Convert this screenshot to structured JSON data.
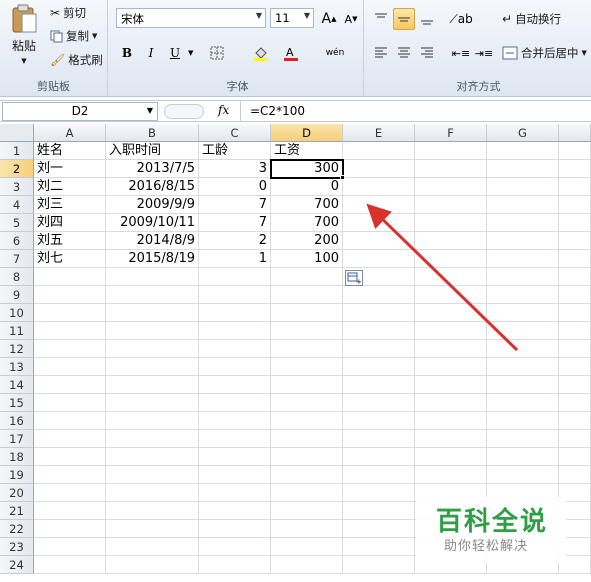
{
  "ribbon": {
    "clipboard": {
      "paste_label": "粘贴",
      "cut_label": "剪切",
      "copy_label": "复制",
      "format_painter_label": "格式刷",
      "group_label": "剪贴板"
    },
    "font": {
      "font_name": "宋体",
      "font_size": "11",
      "bold_label": "B",
      "italic_label": "I",
      "underline_label": "U",
      "group_label": "字体"
    },
    "alignment": {
      "wrap_text_label": "自动换行",
      "merge_center_label": "合并后居中",
      "group_label": "对齐方式"
    }
  },
  "formula_bar": {
    "name_box": "D2",
    "fx_label": "fx",
    "formula": "=C2*100"
  },
  "sheet": {
    "columns": [
      "A",
      "B",
      "C",
      "D",
      "E",
      "F",
      "G"
    ],
    "rows": [
      "1",
      "2",
      "3",
      "4",
      "5",
      "6",
      "7",
      "8",
      "9",
      "10",
      "11",
      "12",
      "13",
      "14",
      "15",
      "16",
      "17",
      "18",
      "19",
      "20",
      "21",
      "22",
      "23",
      "24"
    ],
    "data": [
      [
        "姓名",
        "入职时间",
        "工龄",
        "工资"
      ],
      [
        "刘一",
        "2013/7/5",
        "3",
        "300"
      ],
      [
        "刘二",
        "2016/8/15",
        "0",
        "0"
      ],
      [
        "刘三",
        "2009/9/9",
        "7",
        "700"
      ],
      [
        "刘四",
        "2009/10/11",
        "7",
        "700"
      ],
      [
        "刘五",
        "2014/8/9",
        "2",
        "200"
      ],
      [
        "刘七",
        "2015/8/19",
        "1",
        "100"
      ]
    ]
  },
  "watermark": {
    "title": "百科全说",
    "subtitle": "助你轻松解决"
  },
  "colors": {
    "annotation_arrow": "#d8322c",
    "watermark_green": "#2f9e44"
  }
}
